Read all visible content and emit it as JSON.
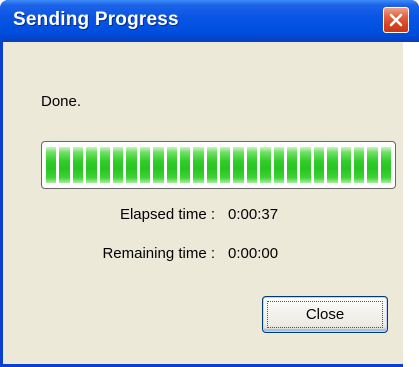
{
  "window": {
    "title": "Sending Progress",
    "close_icon": "close-icon"
  },
  "status": {
    "message": "Done."
  },
  "progress": {
    "fraction": 1.0,
    "segments_visible": 26,
    "bar_color": "#28c521"
  },
  "times": {
    "elapsed_label": "Elapsed time :",
    "elapsed_value": "0:00:37",
    "remaining_label": "Remaining time :",
    "remaining_value": "0:00:00"
  },
  "buttons": {
    "close_label": "Close"
  },
  "colors": {
    "titlebar": "#0050e0",
    "client_bg": "#ece9d8",
    "close_x": "#d8431f"
  }
}
